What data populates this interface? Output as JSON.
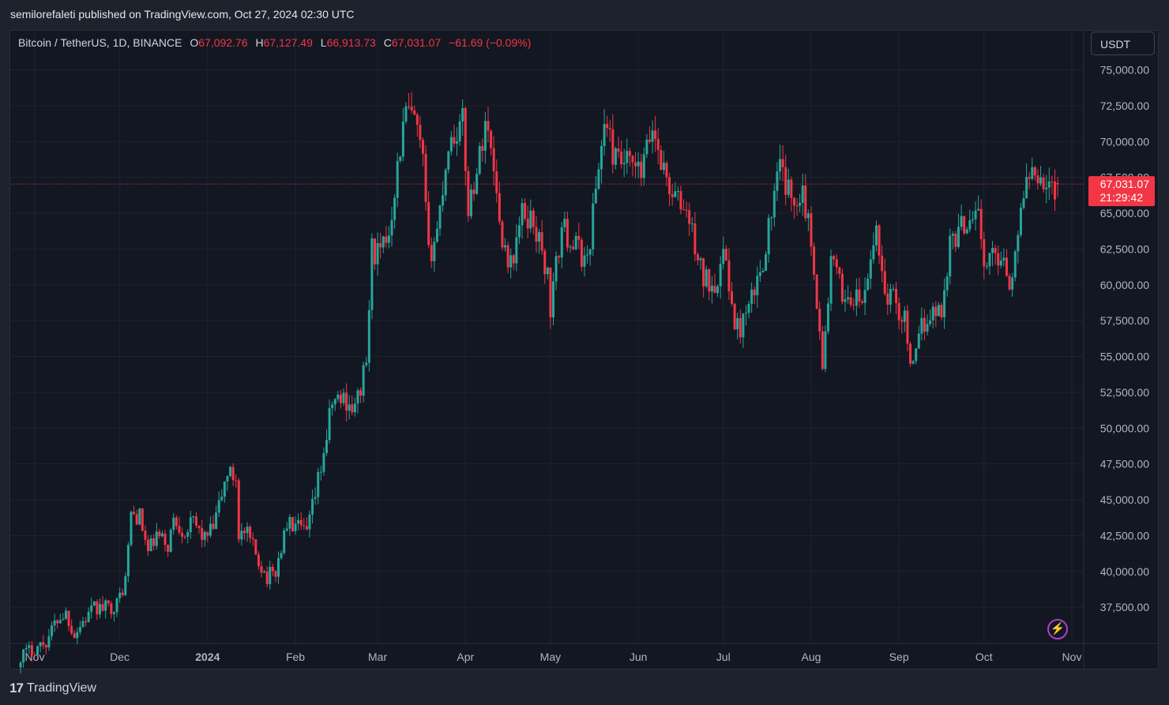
{
  "header": {
    "published_by": "semilorefaleti published on TradingView.com, Oct 27, 2024 02:30 UTC"
  },
  "legend": {
    "symbol": "Bitcoin / TetherUS, 1D, BINANCE",
    "o_label": "O",
    "o_value": "67,092.76",
    "h_label": "H",
    "h_value": "67,127.49",
    "l_label": "L",
    "l_value": "66,913.73",
    "c_label": "C",
    "c_value": "67,031.07",
    "change": "−61.69 (−0.09%)"
  },
  "currency_button": "USDT",
  "footer": {
    "brand_mark": "17",
    "brand_name": "TradingView"
  },
  "price_badge": {
    "price": "67,031.07",
    "countdown": "21:29:42",
    "color": "#f23645"
  },
  "colors": {
    "up": "#26a69a",
    "down": "#f23645",
    "grid": "#1f2330",
    "background": "#131722",
    "axis_text": "#b2b5be"
  },
  "icons": {
    "bolt": "lightning-bolt-icon"
  },
  "chart_data": {
    "type": "candlestick",
    "title": "Bitcoin / TetherUS, 1D, BINANCE",
    "ylim": [
      35000,
      76500
    ],
    "y_ticks": [
      "75,000.00",
      "72,500.00",
      "70,000.00",
      "67,500.00",
      "65,000.00",
      "62,500.00",
      "60,000.00",
      "57,500.00",
      "55,000.00",
      "52,500.00",
      "50,000.00",
      "47,500.00",
      "45,000.00",
      "42,500.00",
      "40,000.00",
      "37,500.00"
    ],
    "y_tick_values": [
      75000,
      72500,
      70000,
      67500,
      65000,
      62500,
      60000,
      57500,
      55000,
      52500,
      50000,
      47500,
      45000,
      42500,
      40000,
      37500
    ],
    "x_ticks": [
      "Nov",
      "Dec",
      "2024",
      "Feb",
      "Mar",
      "Apr",
      "May",
      "Jun",
      "Jul",
      "Aug",
      "Sep",
      "Oct",
      "Nov"
    ],
    "x_tick_dates": [
      "2023-11-01",
      "2023-12-01",
      "2024-01-01",
      "2024-02-01",
      "2024-03-01",
      "2024-04-01",
      "2024-05-01",
      "2024-06-01",
      "2024-07-01",
      "2024-08-01",
      "2024-09-01",
      "2024-10-01",
      "2024-11-01"
    ],
    "last_price": 67031.07,
    "grid": true,
    "daily_close": [
      [
        "2023-10-27",
        34150
      ],
      [
        "2023-11-01",
        34650
      ],
      [
        "2023-11-05",
        35100
      ],
      [
        "2023-11-09",
        36700
      ],
      [
        "2023-11-12",
        37100
      ],
      [
        "2023-11-15",
        35600
      ],
      [
        "2023-11-18",
        36500
      ],
      [
        "2023-11-22",
        37400
      ],
      [
        "2023-11-26",
        37450
      ],
      [
        "2023-11-30",
        37700
      ],
      [
        "2023-12-03",
        39400
      ],
      [
        "2023-12-05",
        44000
      ],
      [
        "2023-12-08",
        43800
      ],
      [
        "2023-12-11",
        41300
      ],
      [
        "2023-12-14",
        42500
      ],
      [
        "2023-12-18",
        41800
      ],
      [
        "2023-12-20",
        43600
      ],
      [
        "2023-12-24",
        42800
      ],
      [
        "2023-12-27",
        43400
      ],
      [
        "2023-12-31",
        42300
      ],
      [
        "2024-01-03",
        43000
      ],
      [
        "2024-01-08",
        46900
      ],
      [
        "2024-01-11",
        46500
      ],
      [
        "2024-01-12",
        42700
      ],
      [
        "2024-01-15",
        42500
      ],
      [
        "2024-01-18",
        41200
      ],
      [
        "2024-01-22",
        39600
      ],
      [
        "2024-01-25",
        40000
      ],
      [
        "2024-01-29",
        43300
      ],
      [
        "2024-02-01",
        43100
      ],
      [
        "2024-02-05",
        42600
      ],
      [
        "2024-02-08",
        45300
      ],
      [
        "2024-02-11",
        48300
      ],
      [
        "2024-02-14",
        51800
      ],
      [
        "2024-02-18",
        52100
      ],
      [
        "2024-02-22",
        51300
      ],
      [
        "2024-02-26",
        54500
      ],
      [
        "2024-02-28",
        62500
      ],
      [
        "2024-03-02",
        62000
      ],
      [
        "2024-03-05",
        63800
      ],
      [
        "2024-03-08",
        68300
      ],
      [
        "2024-03-11",
        72100
      ],
      [
        "2024-03-14",
        71400
      ],
      [
        "2024-03-17",
        68400
      ],
      [
        "2024-03-19",
        61900
      ],
      [
        "2024-03-22",
        63800
      ],
      [
        "2024-03-26",
        69900
      ],
      [
        "2024-03-31",
        71300
      ],
      [
        "2024-04-02",
        65400
      ],
      [
        "2024-04-06",
        68900
      ],
      [
        "2024-04-08",
        71600
      ],
      [
        "2024-04-12",
        67200
      ],
      [
        "2024-04-13",
        64000
      ],
      [
        "2024-04-17",
        61300
      ],
      [
        "2024-04-21",
        64900
      ],
      [
        "2024-04-25",
        64500
      ],
      [
        "2024-04-30",
        60600
      ],
      [
        "2024-05-01",
        58300
      ],
      [
        "2024-05-05",
        64000
      ],
      [
        "2024-05-09",
        62900
      ],
      [
        "2024-05-14",
        61600
      ],
      [
        "2024-05-16",
        65100
      ],
      [
        "2024-05-20",
        71400
      ],
      [
        "2024-05-24",
        68600
      ],
      [
        "2024-05-28",
        68400
      ],
      [
        "2024-06-02",
        67700
      ],
      [
        "2024-06-06",
        71000
      ],
      [
        "2024-06-11",
        67300
      ],
      [
        "2024-06-14",
        66000
      ],
      [
        "2024-06-18",
        65200
      ],
      [
        "2024-06-24",
        60300
      ],
      [
        "2024-06-28",
        60300
      ],
      [
        "2024-07-02",
        62100
      ],
      [
        "2024-07-05",
        56700
      ],
      [
        "2024-07-09",
        57600
      ],
      [
        "2024-07-14",
        60800
      ],
      [
        "2024-07-17",
        64000
      ],
      [
        "2024-07-21",
        68200
      ],
      [
        "2024-07-25",
        65800
      ],
      [
        "2024-07-29",
        66800
      ],
      [
        "2024-08-02",
        61500
      ],
      [
        "2024-08-05",
        54000
      ],
      [
        "2024-08-08",
        61700
      ],
      [
        "2024-08-12",
        59400
      ],
      [
        "2024-08-16",
        58900
      ],
      [
        "2024-08-20",
        59000
      ],
      [
        "2024-08-24",
        64100
      ],
      [
        "2024-08-27",
        59400
      ],
      [
        "2024-08-30",
        59100
      ],
      [
        "2024-09-03",
        57500
      ],
      [
        "2024-09-06",
        53900
      ],
      [
        "2024-09-09",
        57000
      ],
      [
        "2024-09-12",
        58100
      ],
      [
        "2024-09-16",
        58200
      ],
      [
        "2024-09-19",
        62900
      ],
      [
        "2024-09-24",
        64300
      ],
      [
        "2024-09-29",
        65600
      ],
      [
        "2024-10-01",
        60800
      ],
      [
        "2024-10-04",
        62100
      ],
      [
        "2024-10-08",
        62100
      ],
      [
        "2024-10-10",
        60300
      ],
      [
        "2024-10-13",
        62800
      ],
      [
        "2024-10-15",
        67000
      ],
      [
        "2024-10-19",
        68400
      ],
      [
        "2024-10-22",
        67400
      ],
      [
        "2024-10-25",
        66600
      ],
      [
        "2024-10-27",
        67031
      ]
    ]
  }
}
